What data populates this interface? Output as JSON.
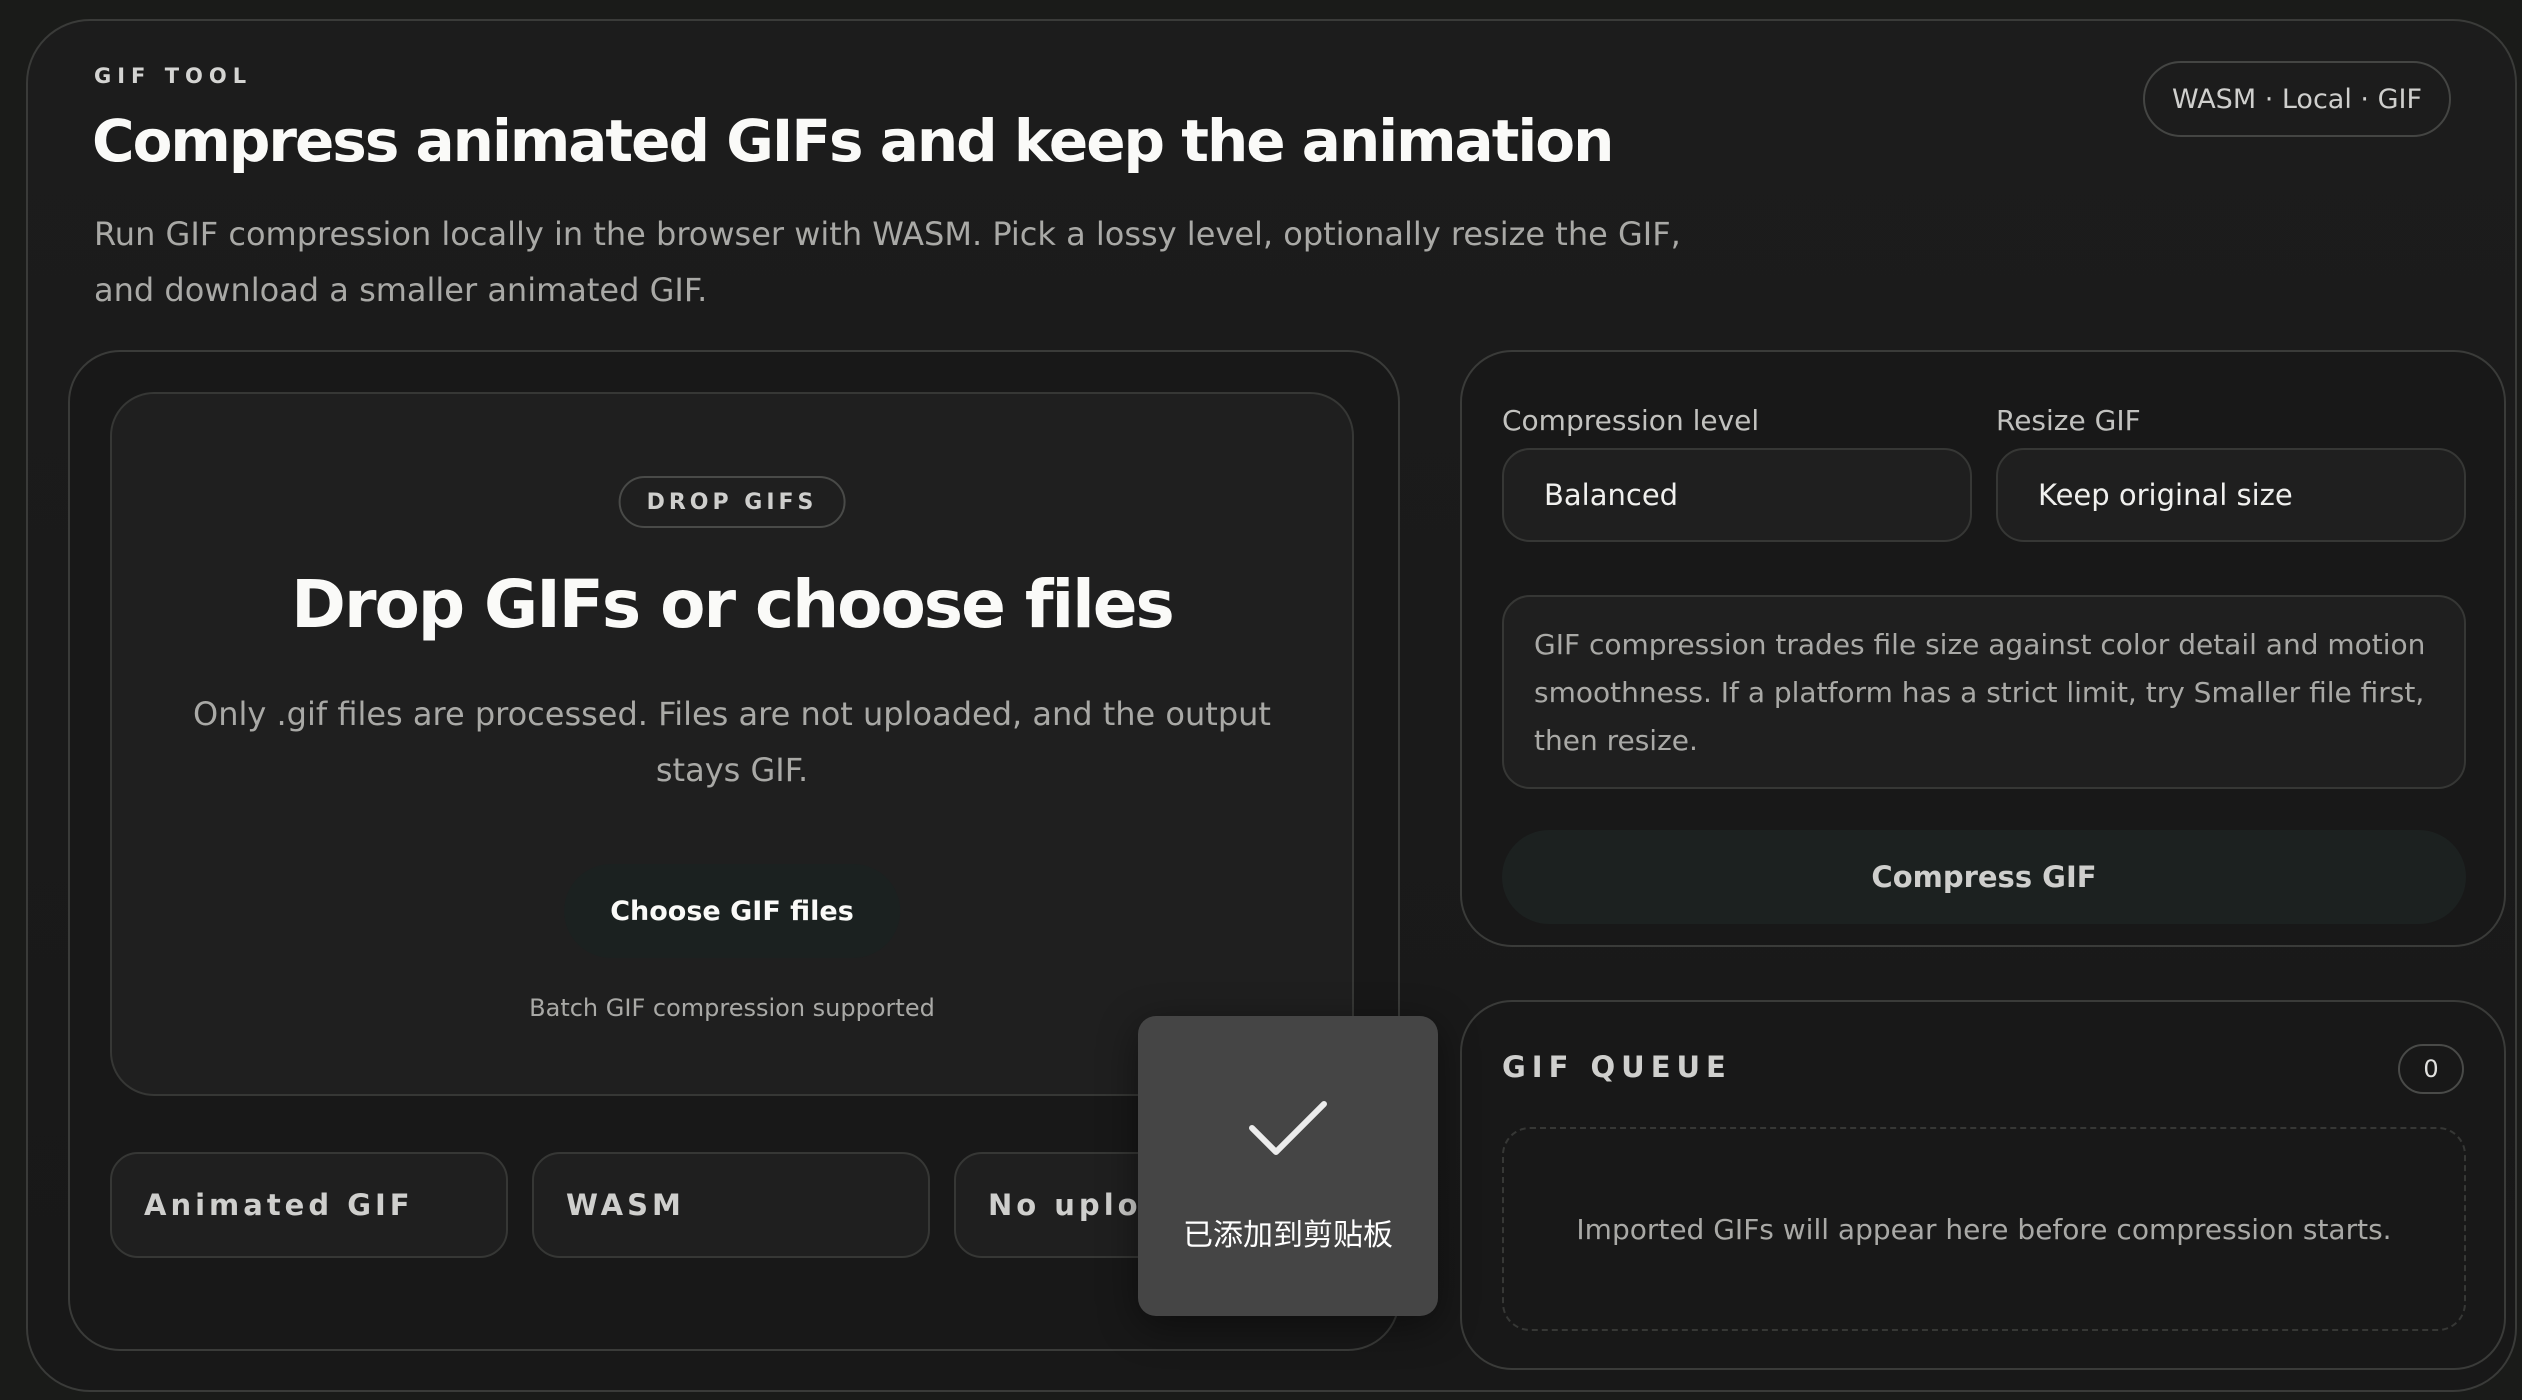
{
  "header": {
    "eyebrow": "GIF TOOL",
    "title": "Compress animated GIFs and keep the animation",
    "subtitle": "Run GIF compression locally in the browser with WASM. Pick a lossy level, optionally resize the GIF, and download a smaller animated GIF.",
    "badge": "WASM · Local · GIF"
  },
  "dropzone": {
    "pill": "DROP GIFS",
    "title": "Drop GIFs or choose files",
    "description": "Only .gif files are processed. Files are not uploaded, and the output stays GIF.",
    "choose_button": "Choose GIF files",
    "note": "Batch GIF compression supported"
  },
  "features": [
    {
      "label": "Animated GIF"
    },
    {
      "label": "WASM"
    },
    {
      "label": "No uploa"
    }
  ],
  "settings": {
    "compression_label": "Compression level",
    "compression_value": "Balanced",
    "resize_label": "Resize GIF",
    "resize_value": "Keep original size",
    "hint": "GIF compression trades file size against color detail and motion smoothness. If a platform has a strict limit, try Smaller file first, then resize.",
    "compress_button": "Compress GIF"
  },
  "queue": {
    "title": "GIF QUEUE",
    "count": "0",
    "empty_text": "Imported GIFs will appear here before compression starts."
  },
  "toast": {
    "icon": "checkmark-icon",
    "text": "已添加到剪贴板"
  },
  "colors": {
    "background": "#181818",
    "toast": "#454545",
    "button_dark_teal": "#1c2120"
  }
}
